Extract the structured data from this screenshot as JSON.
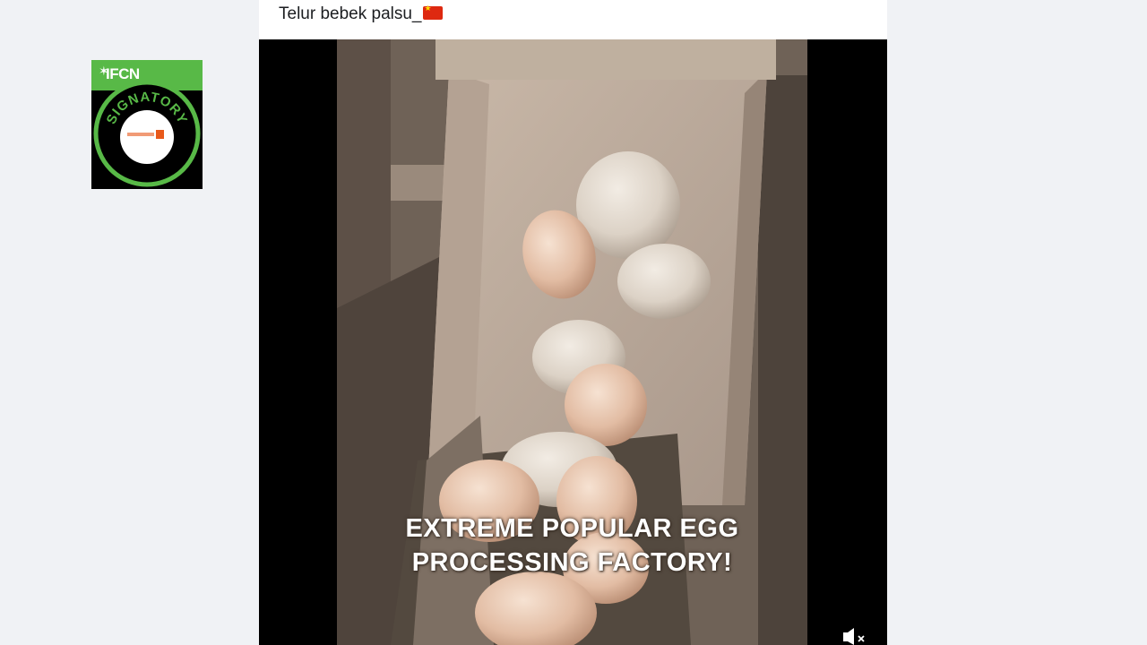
{
  "badge": {
    "brand": "IFCN",
    "ring_text": "SIGNATORY",
    "brand_small": "",
    "colors": {
      "green": "#58b947",
      "black": "#000000",
      "accent": "#e8591a"
    }
  },
  "post": {
    "text": "Telur bebek palsu_",
    "flag_icon": "china-flag-icon"
  },
  "video": {
    "caption_line1": "EXTREME POPULAR EGG",
    "caption_line2": "PROCESSING FACTORY!",
    "mute_icon": "speaker-muted-icon"
  }
}
